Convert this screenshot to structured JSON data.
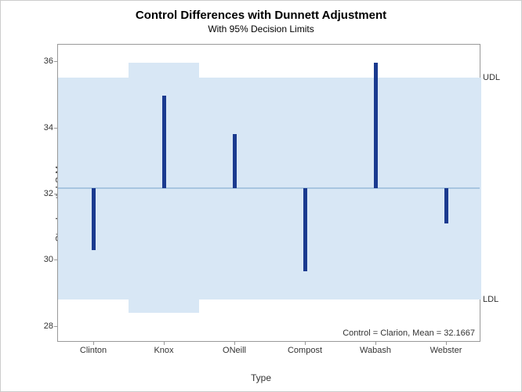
{
  "chart_data": {
    "type": "bar",
    "title": "Control Differences with Dunnett Adjustment",
    "subtitle": "With 95% Decision Limits",
    "xlabel": "Type",
    "ylabel": "StemLength LS-Mean",
    "ylim": [
      27.5,
      36.5
    ],
    "yticks": [
      28,
      30,
      32,
      34,
      36
    ],
    "categories": [
      "Clinton",
      "Knox",
      "ONeill",
      "Compost",
      "Wabash",
      "Webster"
    ],
    "control_mean": 32.1667,
    "udl": 35.5,
    "ldl": 28.8,
    "udl_knox": 35.95,
    "ldl_knox": 28.4,
    "udl_label": "UDL",
    "ldl_label": "LDL",
    "series": [
      {
        "name": "Clinton",
        "low": 30.3,
        "high": 32.1667
      },
      {
        "name": "Knox",
        "low": 32.1667,
        "high": 34.95
      },
      {
        "name": "ONeill",
        "low": 32.1667,
        "high": 33.8
      },
      {
        "name": "Compost",
        "low": 29.65,
        "high": 32.1667
      },
      {
        "name": "Wabash",
        "low": 32.1667,
        "high": 35.95
      },
      {
        "name": "Webster",
        "low": 31.1,
        "high": 32.1667
      }
    ],
    "footnote": "Control = Clarion, Mean = 32.1667"
  }
}
